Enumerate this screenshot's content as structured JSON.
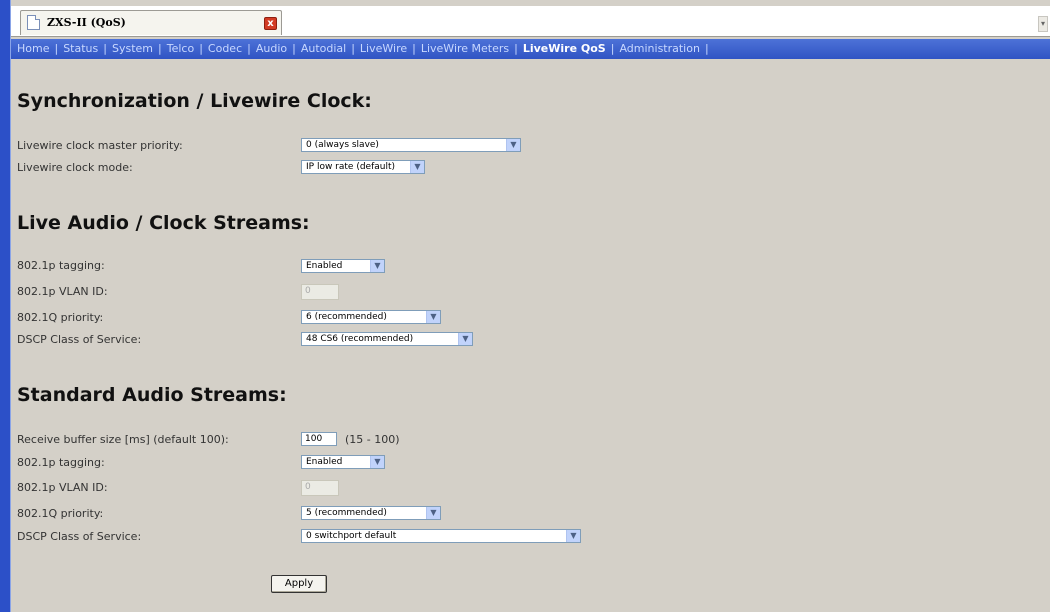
{
  "browser": {
    "tab_title": "ZXS-II (QoS)",
    "close_glyph": "x",
    "scroll_glyph": "▾"
  },
  "nav": {
    "items": [
      {
        "label": "Home",
        "active": false
      },
      {
        "label": "Status",
        "active": false
      },
      {
        "label": "System",
        "active": false
      },
      {
        "label": "Telco",
        "active": false
      },
      {
        "label": "Codec",
        "active": false
      },
      {
        "label": "Audio",
        "active": false
      },
      {
        "label": "Autodial",
        "active": false
      },
      {
        "label": "LiveWire",
        "active": false
      },
      {
        "label": "LiveWire Meters",
        "active": false
      },
      {
        "label": "LiveWire QoS",
        "active": true
      },
      {
        "label": "Administration",
        "active": false
      }
    ],
    "separator": "|"
  },
  "sync": {
    "heading": "Synchronization / Livewire Clock:",
    "master_priority_label": "Livewire clock master priority:",
    "master_priority_value": "0 (always slave)",
    "clock_mode_label": "Livewire clock mode:",
    "clock_mode_value": "IP low rate (default)"
  },
  "live": {
    "heading": "Live Audio / Clock Streams:",
    "tagging_label": "802.1p tagging:",
    "tagging_value": "Enabled",
    "vlan_label": "802.1p VLAN ID:",
    "vlan_value": "0",
    "priority_label": "802.1Q priority:",
    "priority_value": "6 (recommended)",
    "dscp_label": "DSCP Class of Service:",
    "dscp_value": "48 CS6 (recommended)"
  },
  "standard": {
    "heading": "Standard Audio Streams:",
    "buffer_label": "Receive buffer size [ms] (default 100):",
    "buffer_value": "100",
    "buffer_range": "(15 - 100)",
    "tagging_label": "802.1p tagging:",
    "tagging_value": "Enabled",
    "vlan_label": "802.1p VLAN ID:",
    "vlan_value": "0",
    "priority_label": "802.1Q priority:",
    "priority_value": "5 (recommended)",
    "dscp_label": "DSCP Class of Service:",
    "dscp_value": "0 switchport default"
  },
  "apply_label": "Apply",
  "dropdown_glyph": "▼",
  "colors": {
    "nav_bg": "#3a5fd0",
    "page_bg": "#d4d0c8",
    "nav_active": "#ffffff"
  }
}
